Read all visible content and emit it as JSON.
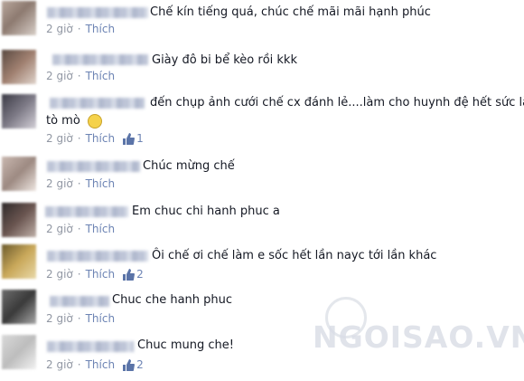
{
  "comments": [
    {
      "text": "Chế kín tiếng quá, chúc chế mãi mãi hạnh phúc",
      "time": "2 giờ",
      "like": "Thích",
      "likes": ""
    },
    {
      "text": "Giày đô bi bể kèo rồi kkk",
      "time": "2 giờ",
      "like": "Thích",
      "likes": ""
    },
    {
      "text": "đến chụp ảnh cưới chế cx đánh lẻ....làm cho huynh đệ hết sức là",
      "text2": "tò mò",
      "time": "2 giờ",
      "like": "Thích",
      "likes": "1"
    },
    {
      "text": "Chúc mừng chế",
      "time": "2 giờ",
      "like": "Thích",
      "likes": ""
    },
    {
      "text": "Em chuc chi hanh phuc a",
      "time": "2 giờ",
      "like": "Thích",
      "likes": ""
    },
    {
      "text": "Ôi chế ơi chế làm e sốc hết lần nayc tới lần khác",
      "time": "2 giờ",
      "like": "Thích",
      "likes": "2"
    },
    {
      "text": "Chuc che hanh phuc",
      "time": "2 giờ",
      "like": "Thích",
      "likes": ""
    },
    {
      "text": "Chuc mung che!",
      "time": "2 giờ",
      "like": "Thích",
      "likes": "2"
    }
  ],
  "watermark": "NGOISAO.VN",
  "colors": {
    "link": "#6d84b4",
    "meta": "#9197a3",
    "text": "#141823"
  }
}
